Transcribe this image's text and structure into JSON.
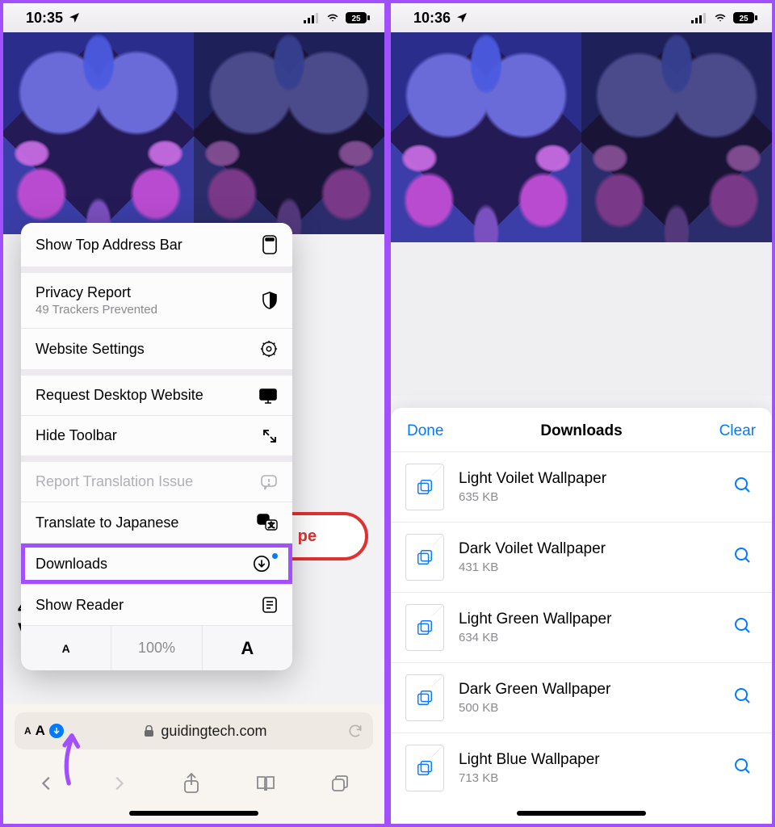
{
  "left": {
    "status": {
      "time": "10:35",
      "battery": "25"
    },
    "hidden_pill_text": "pe",
    "hidden_page_text_line1": "4",
    "hidden_page_text_line2": "V",
    "menu": {
      "show_top": "Show Top Address Bar",
      "privacy": "Privacy Report",
      "privacy_sub": "49 Trackers Prevented",
      "website_settings": "Website Settings",
      "request_desktop": "Request Desktop Website",
      "hide_toolbar": "Hide Toolbar",
      "report_translation": "Report Translation Issue",
      "translate": "Translate to Japanese",
      "downloads": "Downloads",
      "show_reader": "Show Reader",
      "zoom_pct": "100%"
    },
    "url": {
      "domain": "guidingtech.com"
    }
  },
  "right": {
    "status": {
      "time": "10:36",
      "battery": "25"
    },
    "sheet": {
      "done": "Done",
      "title": "Downloads",
      "clear": "Clear",
      "items": [
        {
          "name": "Light Voilet Wallpaper",
          "size": "635 KB"
        },
        {
          "name": "Dark Voilet Wallpaper",
          "size": "431 KB"
        },
        {
          "name": "Light Green Wallpaper",
          "size": "634 KB"
        },
        {
          "name": "Dark Green Wallpaper",
          "size": "500 KB"
        },
        {
          "name": "Light Blue Wallpaper",
          "size": "713 KB"
        }
      ]
    }
  }
}
